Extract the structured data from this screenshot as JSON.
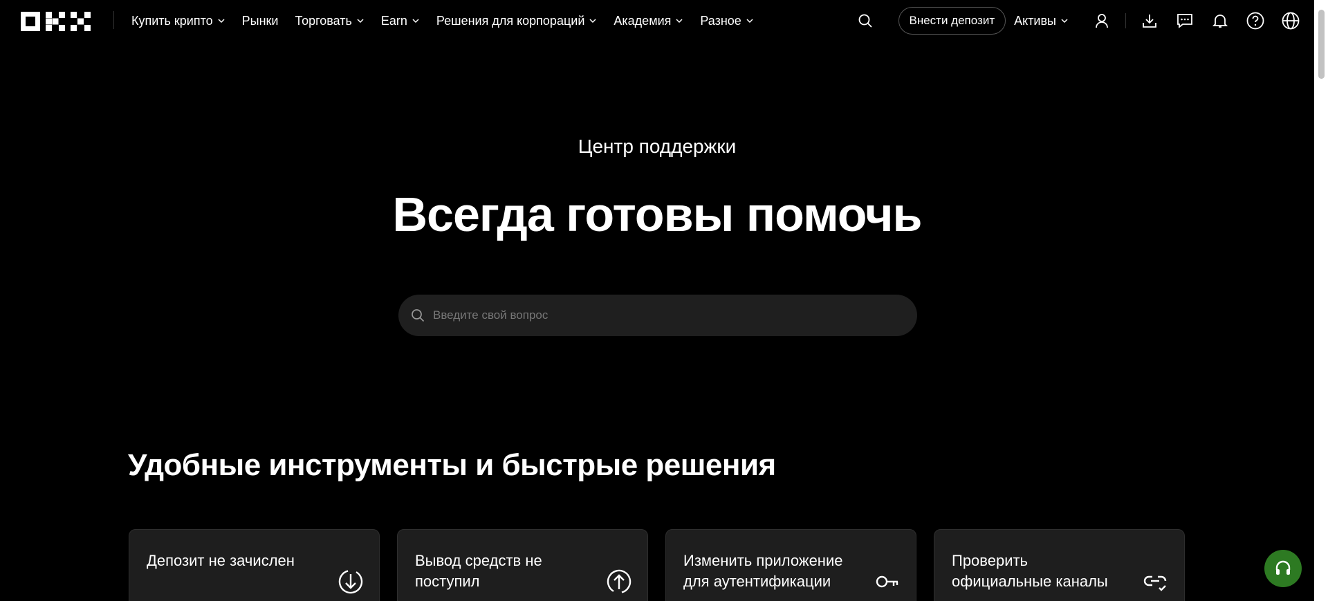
{
  "header": {
    "logo_text": "OKX",
    "nav": [
      {
        "label": "Купить крипто",
        "dropdown": true
      },
      {
        "label": "Рынки",
        "dropdown": false
      },
      {
        "label": "Торговать",
        "dropdown": true
      },
      {
        "label": "Earn",
        "dropdown": true
      },
      {
        "label": "Решения для корпораций",
        "dropdown": true
      },
      {
        "label": "Академия",
        "dropdown": true
      },
      {
        "label": "Разное",
        "dropdown": true
      }
    ],
    "deposit_label": "Внести депозит",
    "assets_label": "Активы",
    "icons": [
      "search-icon",
      "user-icon",
      "download-icon",
      "chat-icon",
      "bell-icon",
      "help-icon",
      "globe-icon"
    ]
  },
  "hero": {
    "subtitle": "Центр поддержки",
    "title": "Всегда готовы помочь",
    "search_placeholder": "Введите свой вопрос"
  },
  "tools": {
    "title": "Удобные инструменты и быстрые решения",
    "cards": [
      {
        "label": "Депозит не зачислен",
        "icon": "deposit-arrow-icon"
      },
      {
        "label": "Вывод средств не поступил",
        "icon": "withdraw-arrow-icon"
      },
      {
        "label": "Изменить приложение для аутентификации",
        "icon": "key-icon"
      },
      {
        "label": "Проверить официальные каналы",
        "icon": "link-check-icon"
      }
    ]
  },
  "colors": {
    "background": "#000000",
    "card_bg": "#1e1e1e",
    "search_bg": "#1f1f1f",
    "support_fab": "#2d7a22"
  }
}
